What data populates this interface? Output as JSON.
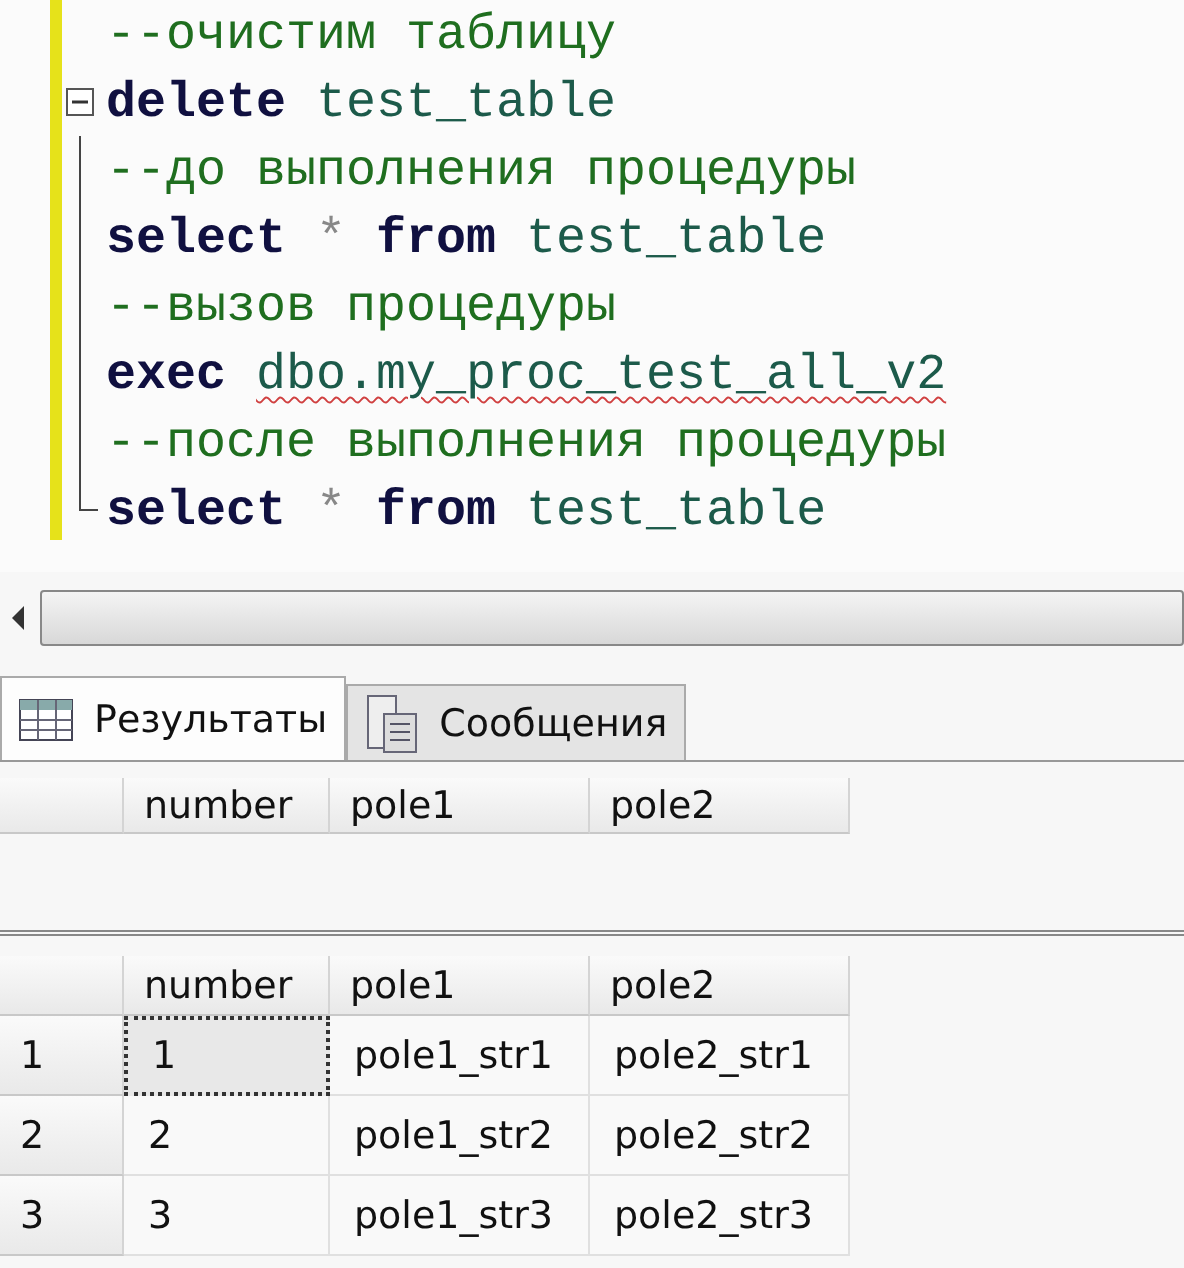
{
  "editor": {
    "lines": [
      {
        "kind": "plain",
        "tokens": [
          {
            "kind": "comment",
            "text": "--очистим таблицу"
          }
        ]
      },
      {
        "kind": "start",
        "tokens": [
          {
            "kind": "keyword",
            "text": "delete"
          },
          {
            "kind": "ident",
            "text": "test_table"
          }
        ]
      },
      {
        "kind": "inner",
        "tokens": [
          {
            "kind": "comment",
            "text": "--до выполнения процедуры"
          }
        ]
      },
      {
        "kind": "inner",
        "tokens": [
          {
            "kind": "keyword",
            "text": "select"
          },
          {
            "kind": "operator",
            "text": "*"
          },
          {
            "kind": "keyword",
            "text": "from"
          },
          {
            "kind": "ident",
            "text": "test_table"
          }
        ]
      },
      {
        "kind": "inner",
        "tokens": [
          {
            "kind": "comment",
            "text": "--вызов процедуры"
          }
        ]
      },
      {
        "kind": "inner",
        "tokens": [
          {
            "kind": "keyword",
            "text": "exec"
          },
          {
            "kind": "error",
            "text": "dbo.my_proc_test_all_v2"
          }
        ]
      },
      {
        "kind": "inner",
        "tokens": [
          {
            "kind": "comment",
            "text": "--после выполнения процедуры"
          }
        ]
      },
      {
        "kind": "end",
        "tokens": [
          {
            "kind": "keyword",
            "text": "select"
          },
          {
            "kind": "operator",
            "text": "*"
          },
          {
            "kind": "keyword",
            "text": "from"
          },
          {
            "kind": "ident",
            "text": "test_table"
          }
        ]
      }
    ]
  },
  "tabs": [
    {
      "label": "Результаты",
      "selected": true
    },
    {
      "label": "Сообщения",
      "selected": false
    }
  ],
  "grids": [
    {
      "columns": [
        "number",
        "pole1",
        "pole2"
      ]
    },
    {
      "columns": [
        "number",
        "pole1",
        "pole2"
      ],
      "rows": [
        {
          "header": "1",
          "cells": [
            {
              "text": "1",
              "focused": true
            },
            {
              "text": "pole1_str1",
              "focused": false
            },
            {
              "text": "pole2_str1",
              "focused": false
            }
          ]
        },
        {
          "header": "2",
          "cells": [
            {
              "text": "2",
              "focused": false
            },
            {
              "text": "pole1_str2",
              "focused": false
            },
            {
              "text": "pole2_str2",
              "focused": false
            }
          ]
        },
        {
          "header": "3",
          "cells": [
            {
              "text": "3",
              "focused": false
            },
            {
              "text": "pole1_str3",
              "focused": false
            },
            {
              "text": "pole2_str3",
              "focused": false
            }
          ]
        }
      ]
    }
  ]
}
